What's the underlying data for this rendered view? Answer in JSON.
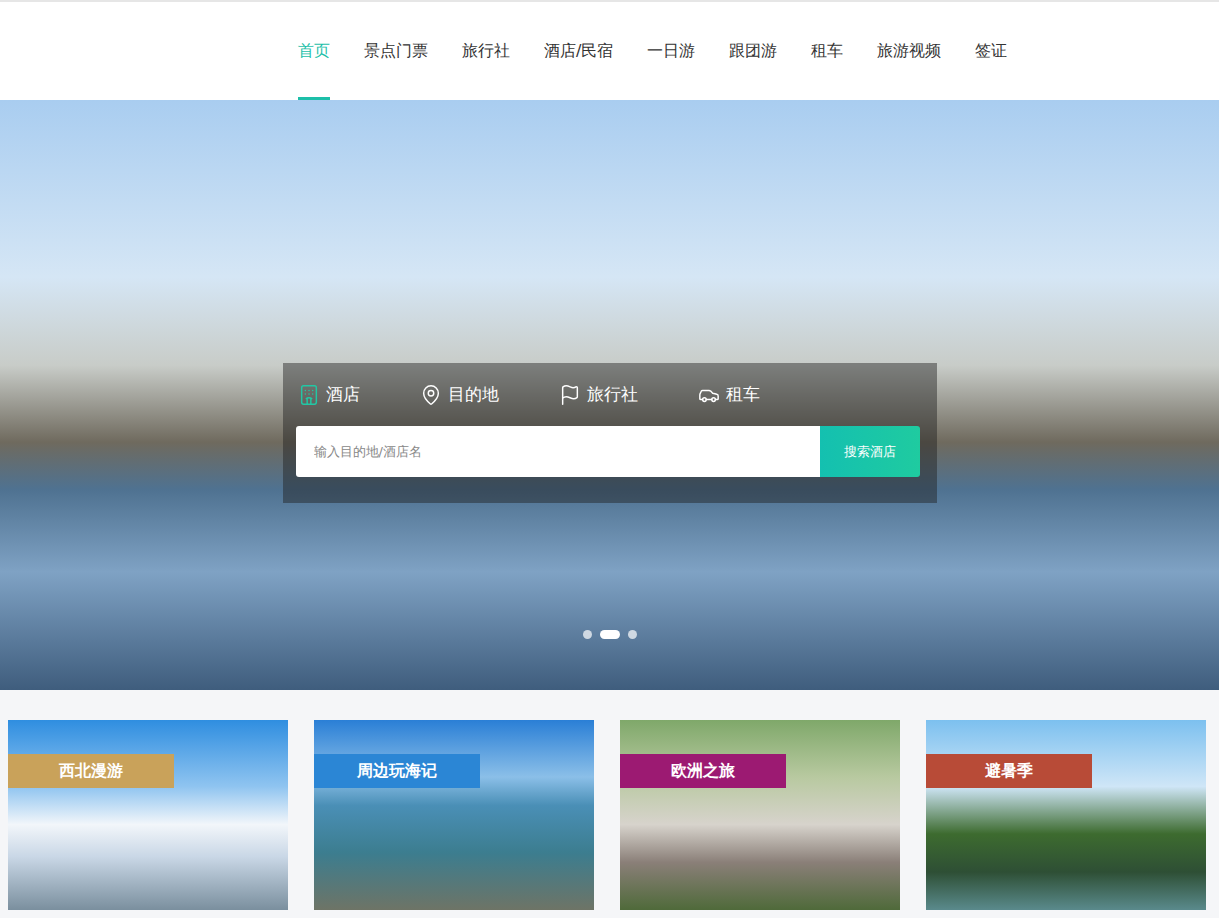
{
  "nav": {
    "items": [
      {
        "label": "首页",
        "selected": true
      },
      {
        "label": "景点门票",
        "selected": false
      },
      {
        "label": "旅行社",
        "selected": false
      },
      {
        "label": "酒店/民宿",
        "selected": false
      },
      {
        "label": "一日游",
        "selected": false
      },
      {
        "label": "跟团游",
        "selected": false
      },
      {
        "label": "租车",
        "selected": false
      },
      {
        "label": "旅游视频",
        "selected": false
      },
      {
        "label": "签证",
        "selected": false
      }
    ]
  },
  "search": {
    "tabs": [
      {
        "label": "酒店",
        "selected": true
      },
      {
        "label": "目的地",
        "selected": false
      },
      {
        "label": "旅行社",
        "selected": false
      },
      {
        "label": "租车",
        "selected": false
      }
    ],
    "placeholder": "输入目的地/酒店名",
    "button": "搜索酒店"
  },
  "carousel": {
    "dots": [
      {
        "selected": false
      },
      {
        "selected": true
      },
      {
        "selected": false
      }
    ]
  },
  "cards": [
    {
      "label": "西北漫游",
      "color": "#c9a25a"
    },
    {
      "label": "周边玩海记",
      "color": "#2b86d5"
    },
    {
      "label": "欧洲之旅",
      "color": "#9c1a72"
    },
    {
      "label": "避暑季",
      "color": "#b84b37"
    }
  ]
}
